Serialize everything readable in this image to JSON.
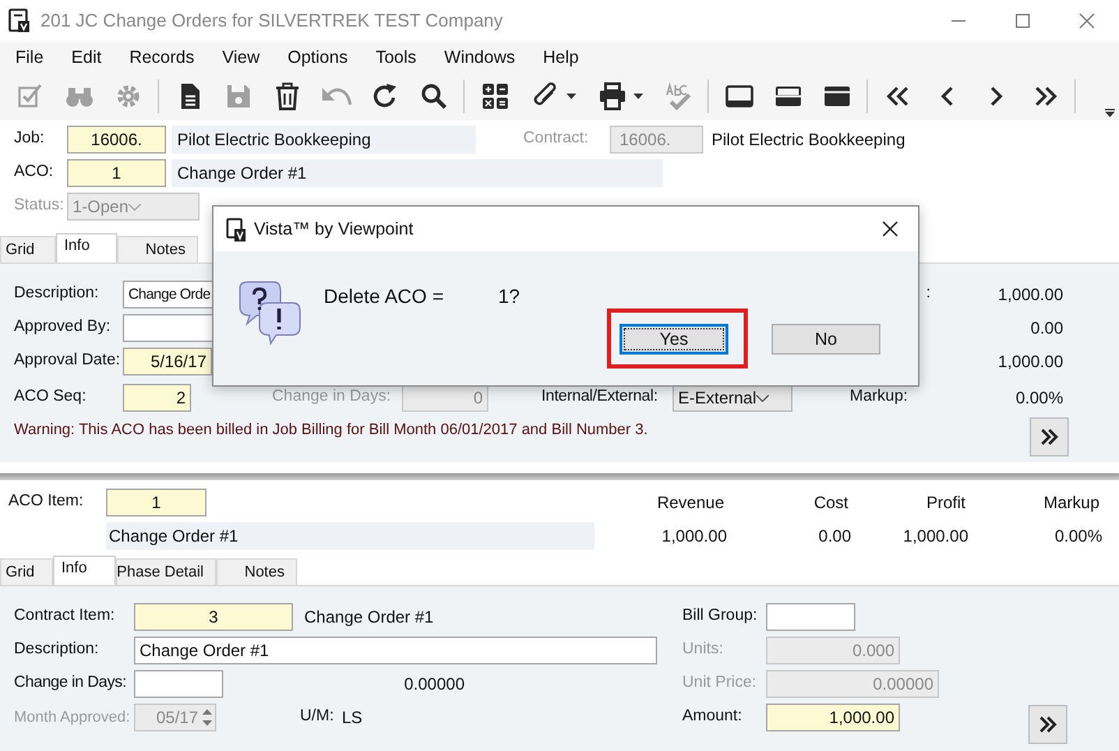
{
  "window": {
    "title": "201 JC Change Orders for SILVERTREK TEST Company"
  },
  "menu": [
    "File",
    "Edit",
    "Records",
    "View",
    "Options",
    "Tools",
    "Windows",
    "Help"
  ],
  "toolbar": [
    [
      {
        "kind": "check",
        "disabled": true,
        "dropdown": false
      },
      {
        "kind": "binoculars",
        "disabled": true,
        "dropdown": false
      },
      {
        "kind": "gear",
        "disabled": true,
        "dropdown": false
      }
    ],
    [
      {
        "kind": "document",
        "disabled": false,
        "dropdown": false
      },
      {
        "kind": "save",
        "disabled": true,
        "dropdown": false
      },
      {
        "kind": "trash",
        "disabled": false,
        "dropdown": false
      },
      {
        "kind": "undo",
        "disabled": true,
        "dropdown": false
      },
      {
        "kind": "refresh",
        "disabled": false,
        "dropdown": false
      },
      {
        "kind": "search",
        "disabled": false,
        "dropdown": false
      }
    ],
    [
      {
        "kind": "calculator",
        "disabled": false,
        "dropdown": false
      },
      {
        "kind": "paperclip",
        "disabled": false,
        "dropdown": true
      },
      {
        "kind": "printer",
        "disabled": false,
        "dropdown": true
      },
      {
        "kind": "spellcheck",
        "disabled": true,
        "dropdown": false
      }
    ],
    [
      {
        "kind": "layout-bottom",
        "disabled": false,
        "dropdown": false
      },
      {
        "kind": "layout-middle",
        "disabled": false,
        "dropdown": false
      },
      {
        "kind": "layout-top",
        "disabled": false,
        "dropdown": false
      }
    ],
    [
      {
        "kind": "first",
        "disabled": false,
        "dropdown": false
      },
      {
        "kind": "prev",
        "disabled": false,
        "dropdown": false
      },
      {
        "kind": "next",
        "disabled": false,
        "dropdown": false
      },
      {
        "kind": "last",
        "disabled": false,
        "dropdown": false
      }
    ]
  ],
  "header": {
    "job": {
      "label": "Job:",
      "value": "16006.",
      "kind": "key",
      "description": "Pilot Electric Bookkeeping"
    },
    "contract": {
      "label": "Contract:",
      "value": "16006.",
      "kind": "disabled",
      "description": "Pilot Electric Bookkeeping"
    },
    "aco": {
      "label": "ACO:",
      "value": "1",
      "kind": "key",
      "description": "Change Order #1"
    },
    "status": {
      "label": "Status:",
      "value": "1-Open",
      "kind": "disabled"
    }
  },
  "upper_tabs": [
    {
      "label": "Grid",
      "selected": false
    },
    {
      "label": "Info",
      "selected": true
    },
    {
      "label": "Notes",
      "selected": false
    }
  ],
  "info": {
    "description": {
      "label": "Description:",
      "value": "Change Orde",
      "kind": "text"
    },
    "approved_by": {
      "label": "Approved By:",
      "kind": "text"
    },
    "approval_date": {
      "label": "Approval Date:",
      "value": "5/16/17",
      "kind": "key"
    },
    "aco_seq": {
      "label": "ACO Seq:",
      "value": "2",
      "kind": "key"
    },
    "change_in_days": {
      "label": "Change in Days:",
      "value": "0",
      "kind": "disabled"
    },
    "internal_external": {
      "label": "Internal/External:",
      "value": "E-External",
      "kind": "select"
    },
    "totals": [
      {
        "label": ":",
        "value": "1,000.00"
      },
      {
        "value": "0.00"
      },
      {
        "value": "1,000.00"
      },
      {
        "label": "Markup:",
        "value": "0.00%"
      }
    ],
    "warning": "Warning: This ACO has been billed in Job Billing for Bill Month 06/01/2017 and Bill Number 3."
  },
  "aco_item": {
    "label": "ACO Item:",
    "value": "1",
    "kind": "key",
    "description": "Change Order #1"
  },
  "summary": [
    {
      "heading": "Revenue",
      "value": "1,000.00"
    },
    {
      "heading": "Cost",
      "value": "0.00"
    },
    {
      "heading": "Profit",
      "value": "1,000.00"
    },
    {
      "heading": "Markup",
      "value": "0.00%"
    }
  ],
  "lower_tabs": [
    {
      "label": "Grid",
      "selected": false
    },
    {
      "label": "Info",
      "selected": true
    },
    {
      "label": "Phase Detail",
      "selected": false
    },
    {
      "label": "Notes",
      "selected": false
    }
  ],
  "item": {
    "contract_item": {
      "label": "Contract Item:",
      "value": "3",
      "kind": "key",
      "description": "Change Order #1"
    },
    "description": {
      "label": "Description:",
      "value": "Change Order #1",
      "kind": "text"
    },
    "change_in_days": {
      "label": "Change in Days:",
      "kind": "text"
    },
    "factor": "0.00000",
    "month_approved": {
      "label": "Month Approved:",
      "value": "05/17",
      "kind": "disabled"
    },
    "um": {
      "label": "U/M:",
      "value": "LS"
    },
    "bill_group": {
      "label": "Bill Group:",
      "kind": "text"
    },
    "units": {
      "label": "Units:",
      "value": "0.000",
      "kind": "disabled"
    },
    "unit_price": {
      "label": "Unit Price:",
      "value": "0.00000",
      "kind": "disabled"
    },
    "amount": {
      "label": "Amount:",
      "value": "1,000.00",
      "kind": "key"
    }
  },
  "dialog": {
    "title": "Vista™ by Viewpoint",
    "message": "Delete ACO =",
    "value": "1?",
    "buttons": [
      {
        "label": "Yes",
        "focused": true,
        "annotated": true
      },
      {
        "label": "No",
        "focused": false,
        "annotated": false
      }
    ]
  }
}
